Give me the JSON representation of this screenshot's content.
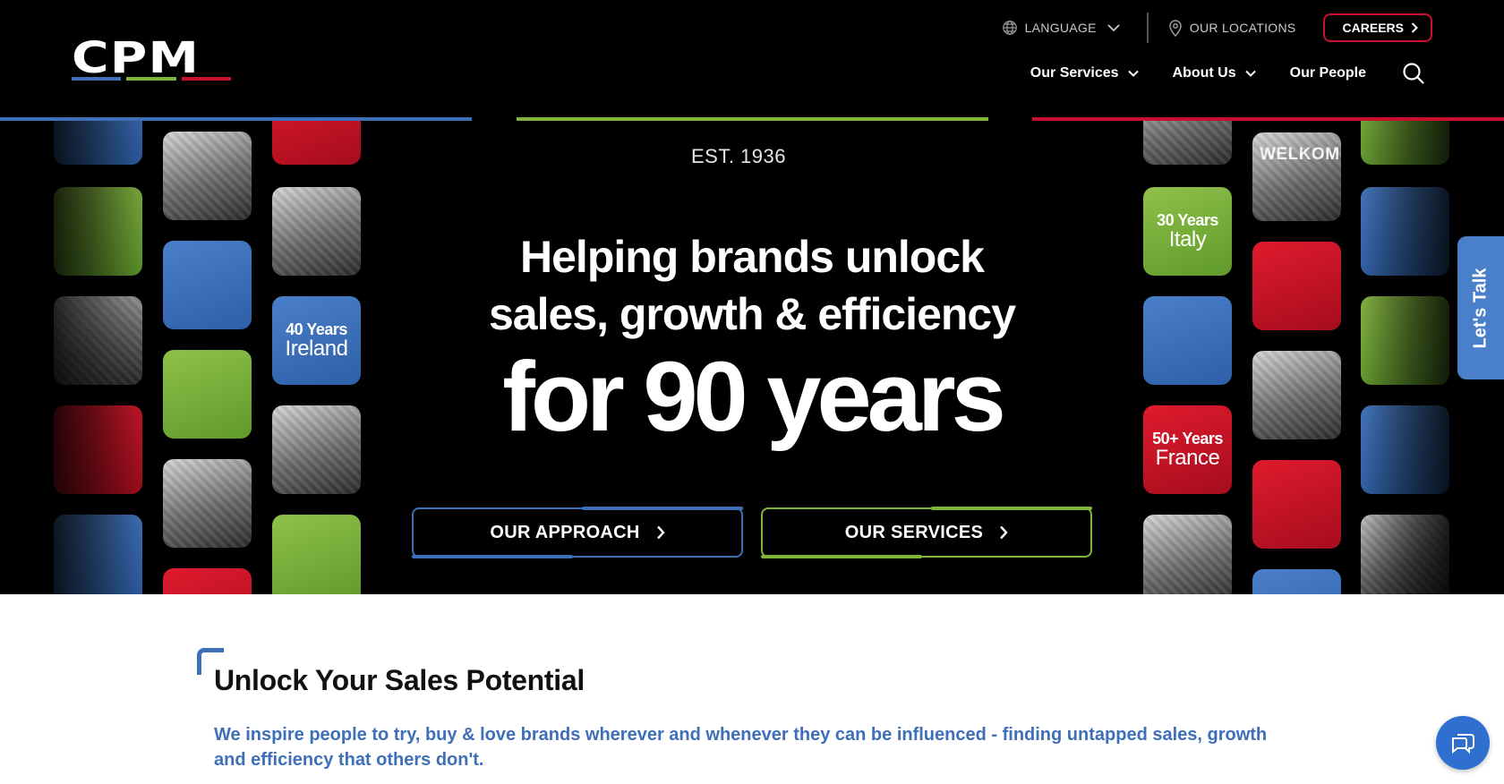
{
  "brand": {
    "logo_text": "CPM",
    "colors": {
      "blue": "#3e6fb8",
      "green": "#7fb43a",
      "red": "#c8102e",
      "black": "#000000"
    }
  },
  "topbar": {
    "language_label": "LANGUAGE",
    "language_icon": "globe-icon",
    "locations_label": "OUR LOCATIONS",
    "locations_icon": "map-pin-icon",
    "careers_label": "CAREERS"
  },
  "nav": {
    "items": [
      {
        "label": "Our Services",
        "has_dropdown": true
      },
      {
        "label": "About Us",
        "has_dropdown": true
      },
      {
        "label": "Our People",
        "has_dropdown": false
      }
    ],
    "search_icon": "search-icon"
  },
  "hero": {
    "est": "EST. 1936",
    "headline_line1": "Helping brands unlock",
    "headline_line2": "sales, growth & efficiency",
    "big_text": "for 90 years",
    "tiles": {
      "ireland_a": "40 Years",
      "ireland_b": "Ireland",
      "italy_a": "30 Years",
      "italy_b": "Italy",
      "france_a": "50+ Years",
      "france_b": "France",
      "welkom": "WELKOM"
    },
    "cta_approach": "OUR APPROACH",
    "cta_services": "OUR SERVICES"
  },
  "side_tab": {
    "label": "Let's Talk"
  },
  "intro": {
    "title": "Unlock Your Sales Potential",
    "text": "We inspire people to try, buy & love brands wherever and whenever they can be influenced - finding untapped sales, growth and efficiency that others don't."
  },
  "chat": {
    "icon": "chat-icon"
  }
}
